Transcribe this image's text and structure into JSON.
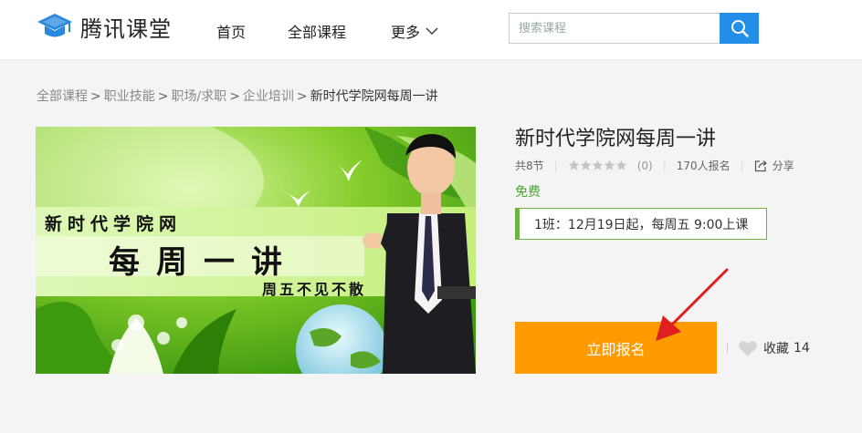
{
  "header": {
    "logo_text": "腾讯课堂",
    "nav": {
      "home": "首页",
      "all_courses": "全部课程",
      "more": "更多"
    },
    "search_placeholder": "搜索课程"
  },
  "breadcrumb": {
    "items": [
      "全部课程",
      "职业技能",
      "职场/求职",
      "企业培训"
    ],
    "separator": ">",
    "current": "新时代学院网每周一讲"
  },
  "cover": {
    "line1": "新时代学院网",
    "line2": "每周一讲",
    "line3": "周五不见不散"
  },
  "course": {
    "title": "新时代学院网每周一讲",
    "lessons": "共8节",
    "rating_count": "(0)",
    "enrolled": "170人报名",
    "share_label": "分享",
    "price": "免费",
    "class_info": "1班：12月19日起，每周五 9:00上课",
    "enroll_label": "立即报名",
    "favorite_label": "收藏",
    "favorite_count": "14"
  },
  "colors": {
    "brand_blue": "#238ee8",
    "enroll_orange": "#ff9a00",
    "free_green": "#4aa334",
    "annotation_red": "#e02020"
  }
}
